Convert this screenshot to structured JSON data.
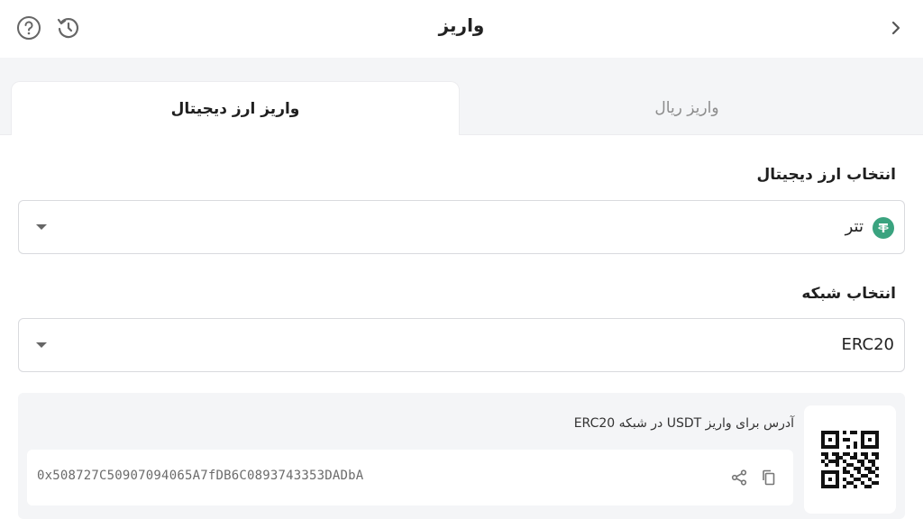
{
  "header": {
    "title": "واریز",
    "icons": {
      "help": "help-circle-icon",
      "history": "history-icon",
      "back": "chevron-right-icon"
    }
  },
  "tabs": [
    {
      "label": "واریز ارز دیجیتال",
      "active": true
    },
    {
      "label": "واریز ریال",
      "active": false
    }
  ],
  "coin_select": {
    "label": "انتخاب ارز دیجیتال",
    "value": "تتر",
    "icon": "tether-icon",
    "icon_color": "#3aa37f"
  },
  "network_select": {
    "label": "انتخاب شبکه",
    "value": "ERC20"
  },
  "deposit": {
    "caption": "آدرس برای واریز USDT در شبکه ERC20",
    "address": "0x508727C50907094065A7fDB6C0893743353DADbA",
    "qr_icon": "qr-code-icon",
    "share_icon": "share-icon",
    "copy_icon": "copy-icon"
  },
  "colors": {
    "background": "#ffffff",
    "panel": "#f4f5f7",
    "accent": "#3aa37f"
  }
}
